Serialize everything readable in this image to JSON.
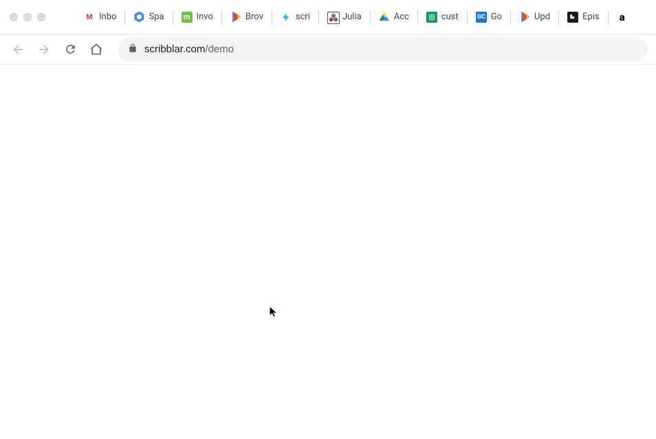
{
  "bookmarks": [
    {
      "icon": "gmail",
      "label": "Inbo"
    },
    {
      "icon": "hexblue",
      "label": "Spa"
    },
    {
      "icon": "mgreen",
      "label": "Invo"
    },
    {
      "icon": "flag",
      "label": "Brov"
    },
    {
      "icon": "lightning",
      "label": "scri"
    },
    {
      "icon": "julia",
      "label": "Julia"
    },
    {
      "icon": "drive",
      "label": "Acc"
    },
    {
      "icon": "sheets",
      "label": "cust"
    },
    {
      "icon": "gcblue",
      "label": "Go"
    },
    {
      "icon": "flag",
      "label": "Upd"
    },
    {
      "icon": "flipboard",
      "label": "Epis"
    },
    {
      "icon": "amazon",
      "label": ""
    }
  ],
  "address": {
    "domain": "scribblar.com",
    "path": "/demo"
  }
}
